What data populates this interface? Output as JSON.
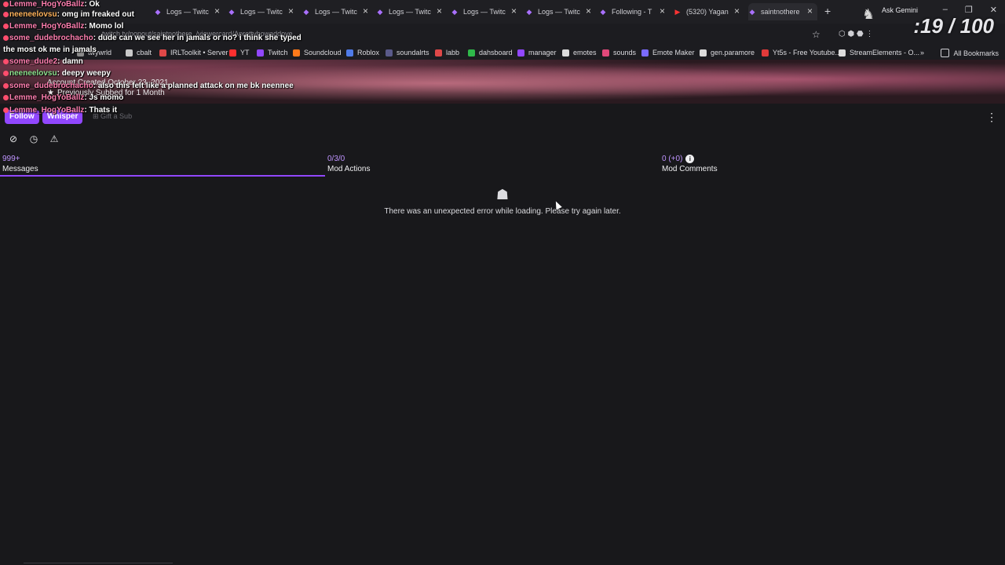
{
  "browser": {
    "tabs": [
      {
        "label": "Logs — Twitc",
        "icon": "twitch-icon"
      },
      {
        "label": "Logs — Twitc",
        "icon": "twitch-icon"
      },
      {
        "label": "Logs — Twitc",
        "icon": "twitch-icon"
      },
      {
        "label": "Logs — Twitc",
        "icon": "twitch-icon"
      },
      {
        "label": "Logs — Twitc",
        "icon": "twitch-icon"
      },
      {
        "label": "Logs — Twitc",
        "icon": "twitch-icon"
      },
      {
        "label": "Following - T",
        "icon": "twitch-icon"
      },
      {
        "label": "(5320) Yagan",
        "icon": "youtube-icon"
      },
      {
        "label": "saintnothere",
        "icon": "twitch-icon",
        "active": true
      }
    ],
    "gemini_label": "Ask Gemini",
    "url": "twitch.tv/popout/saintnothere_/viewercard/Aprettyhowaddove",
    "bookmarks": [
      {
        "label": "twywrld",
        "color": "#8a8a8a"
      },
      {
        "label": "cbalt",
        "color": "#c9c9c9"
      },
      {
        "label": "IRLToolkit • Server",
        "color": "#e04848"
      },
      {
        "label": "YT",
        "color": "#ff2f2f"
      },
      {
        "label": "Twitch",
        "color": "#9147ff"
      },
      {
        "label": "Soundcloud",
        "color": "#ff7a1a"
      },
      {
        "label": "Roblox",
        "color": "#4f7be8"
      },
      {
        "label": "soundalrts",
        "color": "#5a5a8a"
      },
      {
        "label": "labb",
        "color": "#e04848"
      },
      {
        "label": "dahsboard",
        "color": "#2fb84a"
      },
      {
        "label": "manager",
        "color": "#9147ff"
      },
      {
        "label": "emotes",
        "color": "#dcdcdc"
      },
      {
        "label": "sounds",
        "color": "#e0487a"
      },
      {
        "label": "Emote Maker",
        "color": "#7a6bff"
      },
      {
        "label": "gen.paramore",
        "color": "#dcdcdc"
      },
      {
        "label": "Yt5s - Free Youtube...",
        "color": "#e03a3a"
      },
      {
        "label": "StreamElements - O...",
        "color": "#dcdcdc"
      }
    ],
    "all_bookmarks": "All Bookmarks"
  },
  "viewer_card": {
    "account_created": "Account Created October 23, 2021",
    "subbed": "Previously Subbed for 1 Month",
    "follow": "Follow",
    "whisper": "Whisper",
    "gift": "Gift a Sub"
  },
  "mod_stats": {
    "messages": {
      "value": "999+",
      "label": "Messages"
    },
    "mod_actions": {
      "value": "0/3/0",
      "label": "Mod Actions"
    },
    "mod_comments": {
      "value": "0 (+0)",
      "label": "Mod Comments"
    }
  },
  "error_message": "There was an unexpected error while loading. Please try again later.",
  "overlay": {
    "counter": ":19 / 100",
    "chat": [
      {
        "user": "Lemme_HogYoBallz",
        "text": "Ok",
        "color": "pink"
      },
      {
        "user": "neeneelovsu",
        "text": "omg im freaked out",
        "color": "orange"
      },
      {
        "user": "Lemme_HogYoBallz",
        "text": "Momo lol",
        "color": "pink"
      },
      {
        "user": "some_dudebrochacho",
        "text": "dude can we see her in jamals or no? i think she typed",
        "color": "pink"
      },
      {
        "user": "",
        "text": "the most ok me in jamals",
        "color": "pink"
      },
      {
        "user": "some_dude2",
        "text": "damn",
        "color": "pink"
      },
      {
        "user": "neeneelovsu",
        "text": "deepy weepy",
        "color": "green"
      },
      {
        "user": "some_dudebrochacho",
        "text": "also this felt like a planned attack on me bk neennee",
        "color": "pink"
      },
      {
        "user": "Lemme_HogYoBallz",
        "text": "Js momo",
        "color": "pink"
      },
      {
        "user": "Lemme_HogYoBallz",
        "text": "Thats it",
        "color": "pink"
      }
    ]
  }
}
